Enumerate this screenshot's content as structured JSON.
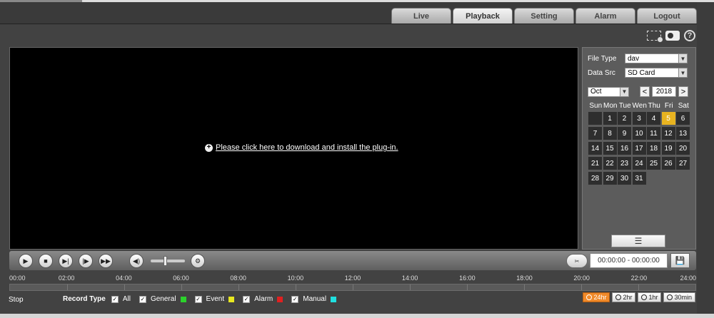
{
  "nav": {
    "tabs": [
      {
        "label": "Live",
        "active": false
      },
      {
        "label": "Playback",
        "active": true
      },
      {
        "label": "Setting",
        "active": false
      },
      {
        "label": "Alarm",
        "active": false
      },
      {
        "label": "Logout",
        "active": false
      }
    ]
  },
  "video": {
    "plugin_message": "Please click here to download and install the plug-in."
  },
  "panel": {
    "file_type_label": "File Type",
    "file_type_value": "dav",
    "data_src_label": "Data Src",
    "data_src_value": "SD Card",
    "month_value": "Oct",
    "year_value": "2018",
    "prev_symbol": "<",
    "next_symbol": ">",
    "weekdays": [
      "Sun",
      "Mon",
      "Tue",
      "Wen",
      "Thu",
      "Fri",
      "Sat"
    ],
    "days": [
      "1",
      "2",
      "3",
      "4",
      "5",
      "6",
      "7",
      "8",
      "9",
      "10",
      "11",
      "12",
      "13",
      "14",
      "15",
      "16",
      "17",
      "18",
      "19",
      "20",
      "21",
      "22",
      "23",
      "24",
      "25",
      "26",
      "27",
      "28",
      "29",
      "30",
      "31"
    ],
    "first_weekday_offset": 1,
    "selected_day": "5",
    "selected_color": "#e8b320"
  },
  "controls": {
    "time_range": "00:00:00 - 00:00:00"
  },
  "timeline": {
    "labels": [
      "00:00",
      "02:00",
      "04:00",
      "06:00",
      "08:00",
      "10:00",
      "12:00",
      "14:00",
      "16:00",
      "18:00",
      "20:00",
      "22:00",
      "24:00"
    ]
  },
  "status": {
    "state": "Stop"
  },
  "record_type": {
    "title": "Record Type",
    "items": [
      {
        "label": "All",
        "checked": true,
        "color": null
      },
      {
        "label": "General",
        "checked": true,
        "color": "#2bd32b"
      },
      {
        "label": "Event",
        "checked": true,
        "color": "#e8e820"
      },
      {
        "label": "Alarm",
        "checked": true,
        "color": "#e02020"
      },
      {
        "label": "Manual",
        "checked": true,
        "color": "#20e0e0"
      }
    ]
  },
  "zoom": {
    "options": [
      {
        "label": "24hr",
        "active": true
      },
      {
        "label": "2hr",
        "active": false
      },
      {
        "label": "1hr",
        "active": false
      },
      {
        "label": "30min",
        "active": false
      }
    ]
  }
}
